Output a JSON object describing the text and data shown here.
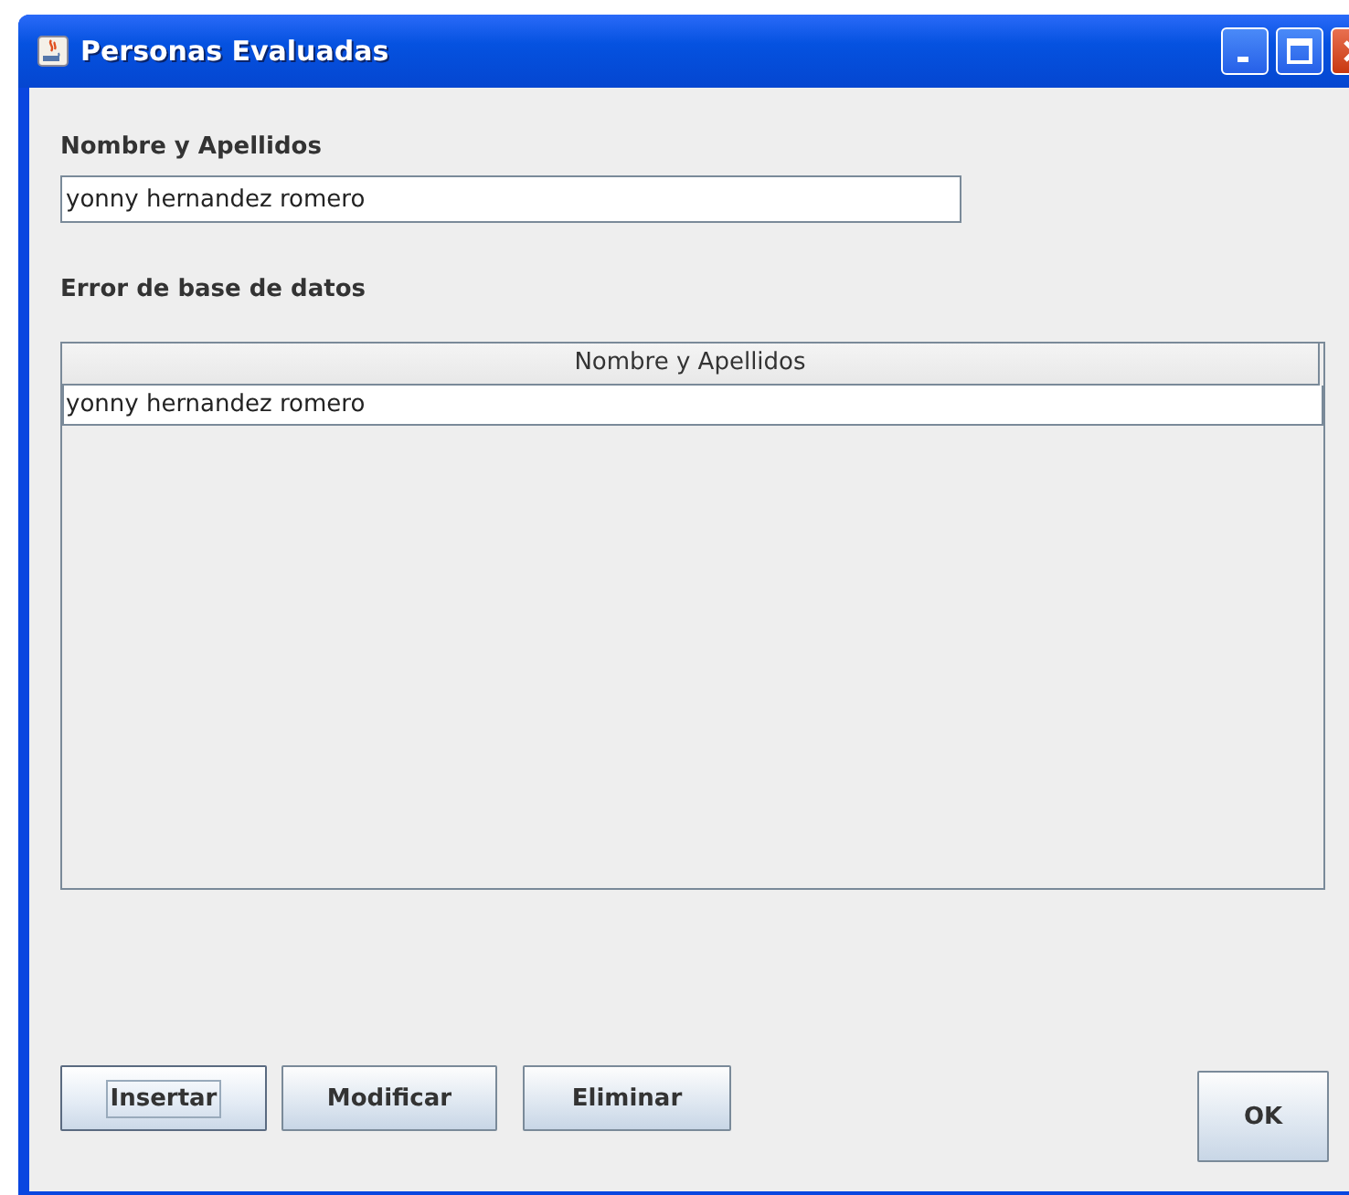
{
  "window": {
    "title": "Personas Evaluadas"
  },
  "name_field": {
    "label": "Nombre y Apellidos",
    "value": "yonny hernandez romero"
  },
  "message": "Error de base de datos",
  "table": {
    "columns": [
      "Nombre y Apellidos"
    ],
    "rows": [
      [
        "yonny hernandez romero"
      ]
    ]
  },
  "buttons": [
    {
      "label": "Insertar",
      "focused": true
    },
    {
      "label": "Modificar",
      "focused": false
    },
    {
      "label": "Eliminar",
      "focused": false
    }
  ],
  "ok_button": {
    "label": "OK"
  }
}
